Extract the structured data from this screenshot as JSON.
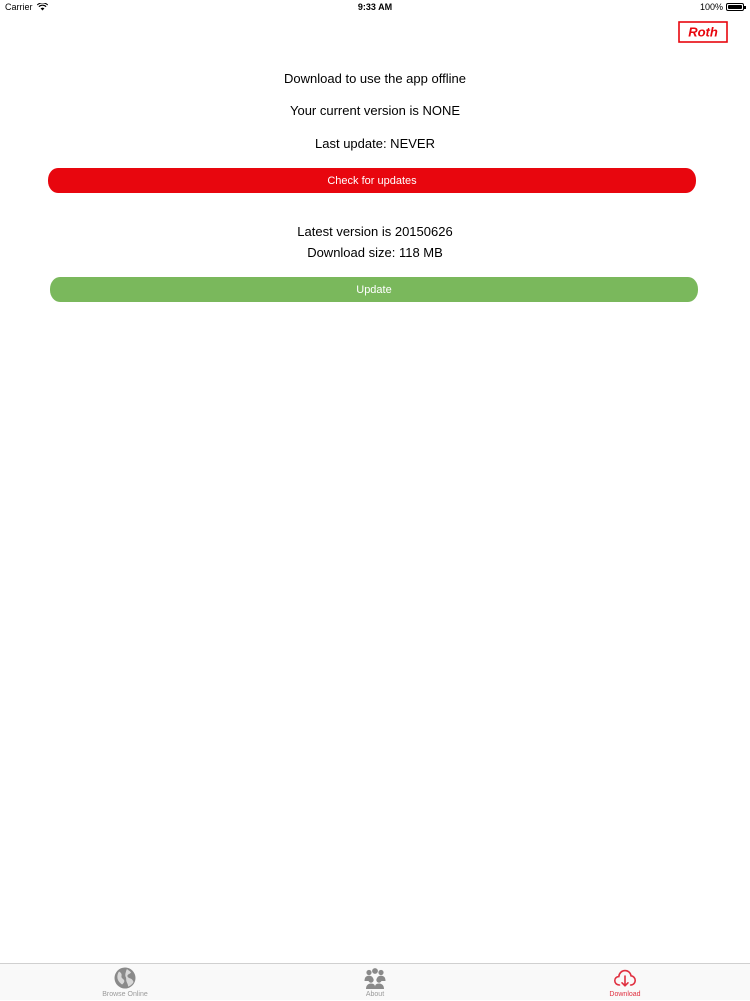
{
  "status_bar": {
    "carrier": "Carrier",
    "time": "9:33 AM",
    "battery": "100%",
    "battery_level": 1.0
  },
  "brand": {
    "logo_text": "Roth",
    "color": "#e8060e"
  },
  "download": {
    "intro": "Download to use the app offline",
    "current_version": "Your current version is NONE",
    "last_update": "Last update: NEVER",
    "check_button_label": "Check for updates",
    "latest_version": "Latest version is 20150626",
    "download_size": "Download size: 118 MB",
    "update_button_label": "Update"
  },
  "colors": {
    "check_button": "#e8060e",
    "update_button": "#7ab85c",
    "tab_active": "#e03040",
    "tab_inactive": "#9a9a9a"
  },
  "tab_bar": {
    "items": [
      {
        "label": "Browse Online",
        "icon": "globe-icon",
        "active": false
      },
      {
        "label": "About",
        "icon": "people-icon",
        "active": false
      },
      {
        "label": "Download",
        "icon": "cloud-download-icon",
        "active": true
      }
    ]
  }
}
